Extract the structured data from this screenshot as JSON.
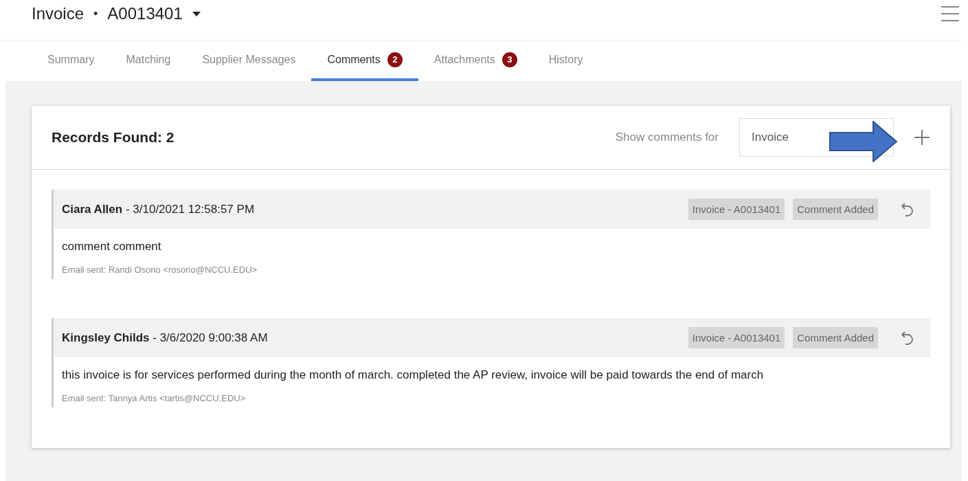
{
  "header": {
    "title": "Invoice",
    "separator": "•",
    "number": "A0013401"
  },
  "tabs": [
    {
      "label": "Summary",
      "selected": false
    },
    {
      "label": "Matching",
      "selected": false
    },
    {
      "label": "Supplier Messages",
      "selected": false
    },
    {
      "label": "Comments",
      "selected": true,
      "badge": "2"
    },
    {
      "label": "Attachments",
      "selected": false,
      "badge": "3"
    },
    {
      "label": "History",
      "selected": false
    }
  ],
  "panel": {
    "records_found": "Records Found: 2",
    "filter_label": "Show comments for",
    "filter_value": "Invoice"
  },
  "comments": [
    {
      "author": "Ciara Allen",
      "timestamp": " - 3/10/2021 12:58:57 PM",
      "tags": [
        "Invoice - A0013401",
        "Comment Added"
      ],
      "text": "comment comment",
      "email": "Email sent: Randi Osorio <rosorio@NCCU.EDU>"
    },
    {
      "author": "Kingsley Childs",
      "timestamp": " - 3/6/2020 9:00:38 AM",
      "tags": [
        "Invoice - A0013401",
        "Comment Added"
      ],
      "text": "this invoice is for services performed during the month of march. completed the AP review, invoice will be paid towards the end of march",
      "email": "Email sent: Tannya Artis <tartis@NCCU.EDU>"
    }
  ]
}
